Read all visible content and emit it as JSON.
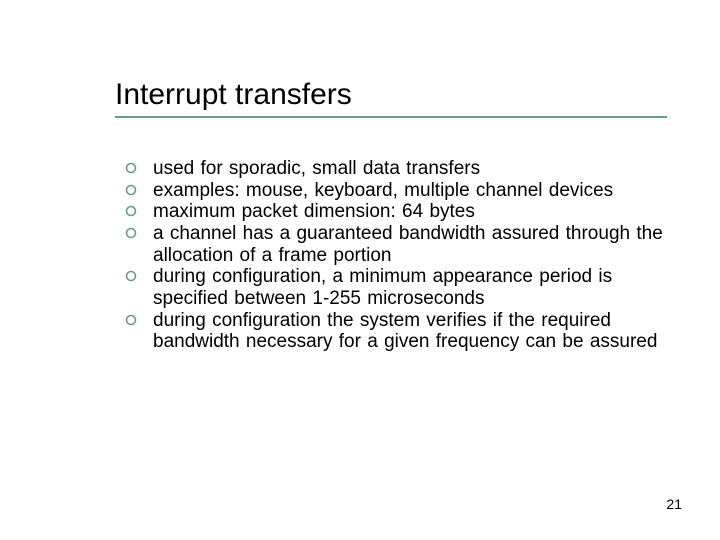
{
  "slide": {
    "title": "Interrupt transfers",
    "bullets": [
      "used for sporadic, small data transfers",
      "examples: mouse, keyboard, multiple channel devices",
      "maximum packet dimension: 64 bytes",
      "a channel has a guaranteed bandwidth assured through the allocation of a frame portion",
      "during configuration, a minimum appearance period is specified  between 1-255 microseconds",
      "during configuration the system verifies if the required bandwidth necessary for a given frequency can be assured"
    ],
    "page_number": "21"
  },
  "theme": {
    "accent": "#6a9a8f"
  }
}
